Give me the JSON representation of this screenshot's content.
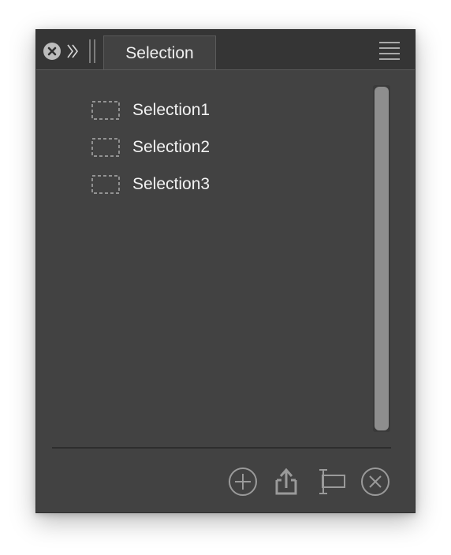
{
  "panel": {
    "tab_label": "Selection",
    "controls": {
      "close_icon": "close-circle-icon",
      "collapse_icon": "double-chevron-right-icon",
      "grip_icon": "grip-icon",
      "menu_icon": "hamburger-menu-icon"
    }
  },
  "list": {
    "items": [
      {
        "label": "Selection1",
        "icon": "marquee-selection-icon"
      },
      {
        "label": "Selection2",
        "icon": "marquee-selection-icon"
      },
      {
        "label": "Selection3",
        "icon": "marquee-selection-icon"
      }
    ]
  },
  "footer": {
    "buttons": [
      {
        "icon": "add-icon",
        "action": "add"
      },
      {
        "icon": "export-icon",
        "action": "export"
      },
      {
        "icon": "rename-icon",
        "action": "rename"
      },
      {
        "icon": "delete-icon",
        "action": "delete"
      }
    ]
  },
  "colors": {
    "panel_bg": "#424242",
    "titlebar_bg": "#353535",
    "text": "#f0f0f0",
    "icon": "#9a9a9a",
    "scroll_thumb": "#8e8e8e"
  }
}
